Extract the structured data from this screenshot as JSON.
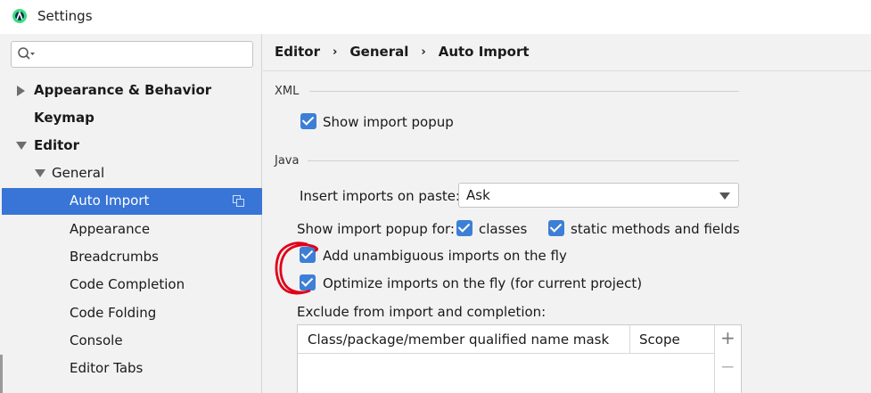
{
  "window": {
    "title": "Settings"
  },
  "search": {
    "placeholder": ""
  },
  "sidebar": {
    "items": [
      {
        "label": "Appearance & Behavior",
        "bold": true,
        "level": 0,
        "expanded": false
      },
      {
        "label": "Keymap",
        "bold": true,
        "level": 0
      },
      {
        "label": "Editor",
        "bold": true,
        "level": 0,
        "expanded": true
      },
      {
        "label": "General",
        "bold": false,
        "level": 1,
        "expanded": true
      },
      {
        "label": "Auto Import",
        "bold": false,
        "level": 2,
        "selected": true
      },
      {
        "label": "Appearance",
        "level": 2
      },
      {
        "label": "Breadcrumbs",
        "level": 2
      },
      {
        "label": "Code Completion",
        "level": 2
      },
      {
        "label": "Code Folding",
        "level": 2
      },
      {
        "label": "Console",
        "level": 2
      },
      {
        "label": "Editor Tabs",
        "level": 2
      }
    ]
  },
  "breadcrumb": [
    "Editor",
    "General",
    "Auto Import"
  ],
  "xml": {
    "title": "XML",
    "show_import_popup": {
      "label": "Show import popup",
      "checked": true
    }
  },
  "java": {
    "title": "Java",
    "insert_imports_label": "Insert imports on paste:",
    "insert_imports_value": "Ask",
    "show_popup_for_label": "Show import popup for:",
    "classes": {
      "label": "classes",
      "checked": true
    },
    "static_methods": {
      "label": "static methods and fields",
      "checked": true
    },
    "add_unambiguous": {
      "label": "Add unambiguous imports on the fly",
      "checked": true
    },
    "optimize_imports": {
      "label": "Optimize imports on the fly (for current project)",
      "checked": true
    },
    "exclude_label": "Exclude from import and completion:",
    "table": {
      "columns": [
        "Class/package/member qualified name mask",
        "Scope"
      ],
      "rows": []
    },
    "add_button": "+",
    "remove_button": "−"
  },
  "colors": {
    "selection": "#3875d6",
    "checkbox": "#3d7fd6",
    "annotation": "#e0001a"
  }
}
